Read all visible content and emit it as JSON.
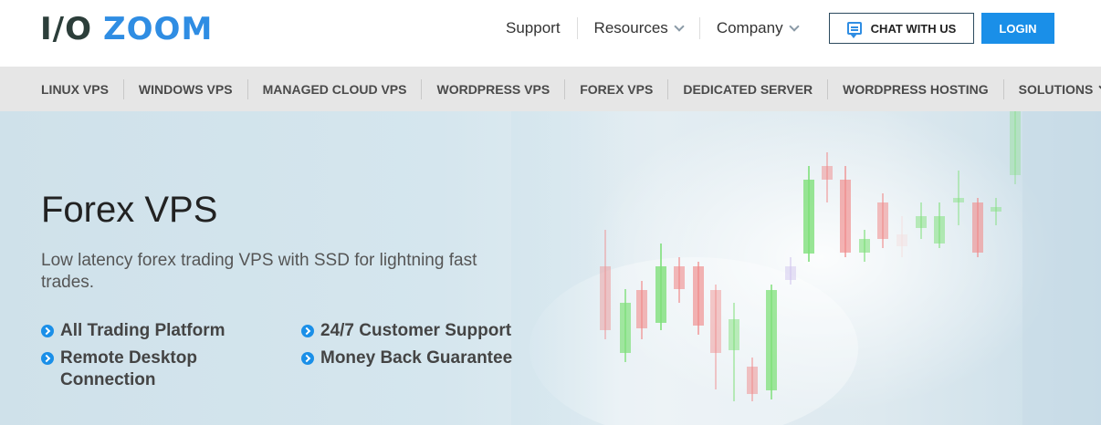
{
  "header": {
    "logo": {
      "io": "I/O",
      "zoom": "ZOOM"
    },
    "nav": [
      {
        "label": "Support",
        "dropdown": false
      },
      {
        "label": "Resources",
        "dropdown": true
      },
      {
        "label": "Company",
        "dropdown": true
      }
    ],
    "chat_label": "CHAT WITH US",
    "login_label": "LOGIN"
  },
  "product_nav": [
    {
      "label": "LINUX VPS"
    },
    {
      "label": "WINDOWS VPS"
    },
    {
      "label": "MANAGED CLOUD VPS"
    },
    {
      "label": "WORDPRESS VPS"
    },
    {
      "label": "FOREX VPS"
    },
    {
      "label": "DEDICATED SERVER"
    },
    {
      "label": "WORDPRESS HOSTING"
    },
    {
      "label": "SOLUTIONS"
    }
  ],
  "hero": {
    "title": "Forex VPS",
    "subtitle": "Low latency forex trading VPS with SSD for lightning fast trades.",
    "features": [
      "All Trading Platform",
      "24/7 Customer Support",
      "Remote Desktop Connection",
      "Money Back Guarantee"
    ]
  },
  "colors": {
    "accent": "#1a8fe8",
    "logo_dark": "#2c3e3a",
    "logo_blue": "#2f8de3",
    "candle_up": "#7fe07a",
    "candle_down": "#f08a8a"
  }
}
